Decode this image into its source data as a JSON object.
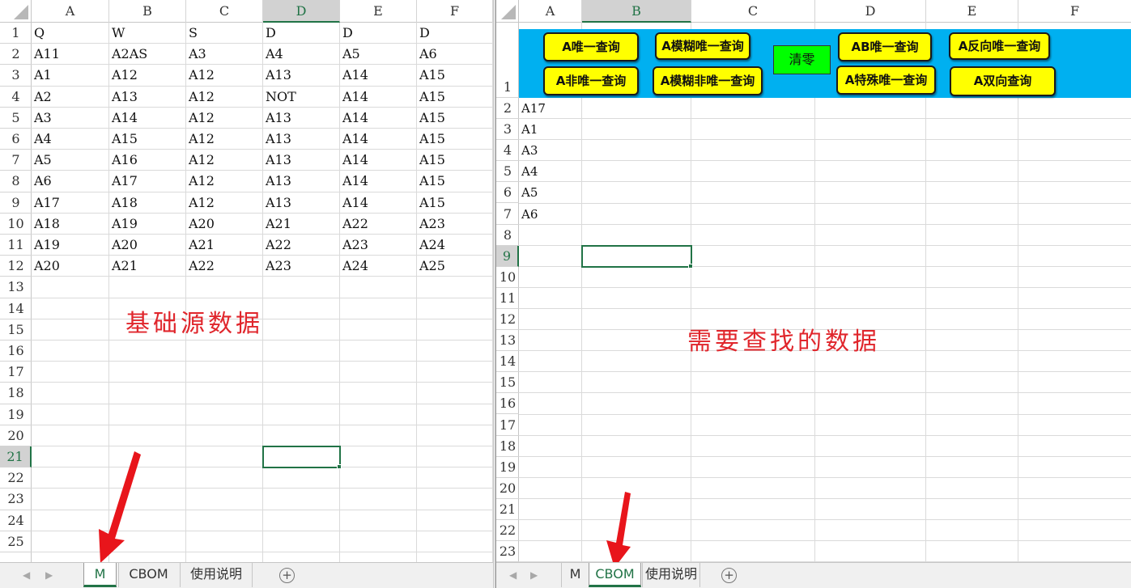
{
  "left_sheet": {
    "columns": [
      "A",
      "B",
      "C",
      "D",
      "E",
      "F"
    ],
    "active_column": "D",
    "row_numbers": [
      "1",
      "2",
      "3",
      "4",
      "5",
      "6",
      "7",
      "8",
      "9",
      "10",
      "11",
      "12",
      "13",
      "14",
      "15",
      "16",
      "17",
      "18",
      "19",
      "20",
      "21",
      "22",
      "23",
      "24",
      "25"
    ],
    "active_row": "21",
    "rows": [
      [
        "Q",
        "W",
        "S",
        "D",
        "D",
        "D"
      ],
      [
        "A11",
        "A2AS",
        "A3",
        "A4",
        "A5",
        "A6"
      ],
      [
        "A1",
        "A12",
        "A12",
        "A13",
        "A14",
        "A15"
      ],
      [
        "A2",
        "A13",
        "A12",
        "NOT",
        "A14",
        "A15"
      ],
      [
        "A3",
        "A14",
        "A12",
        "A13",
        "A14",
        "A15"
      ],
      [
        "A4",
        "A15",
        "A12",
        "A13",
        "A14",
        "A15"
      ],
      [
        "A5",
        "A16",
        "A12",
        "A13",
        "A14",
        "A15"
      ],
      [
        "A6",
        "A17",
        "A12",
        "A13",
        "A14",
        "A15"
      ],
      [
        "A17",
        "A18",
        "A12",
        "A13",
        "A14",
        "A15"
      ],
      [
        "A18",
        "A19",
        "A20",
        "A21",
        "A22",
        "A23"
      ],
      [
        "A19",
        "A20",
        "A21",
        "A22",
        "A23",
        "A24"
      ],
      [
        "A20",
        "A21",
        "A22",
        "A23",
        "A24",
        "A25"
      ]
    ],
    "annotation": "基础源数据",
    "tabs": [
      "M",
      "CBOM",
      "使用说明"
    ],
    "active_tab": "M"
  },
  "right_sheet": {
    "columns": [
      "A",
      "B",
      "C",
      "D",
      "E",
      "F"
    ],
    "active_column": "B",
    "row_numbers": [
      "1",
      "2",
      "3",
      "4",
      "5",
      "6",
      "7",
      "8",
      "9",
      "10",
      "11",
      "12",
      "13",
      "14",
      "15",
      "16",
      "17",
      "18",
      "19",
      "20",
      "21",
      "22",
      "23"
    ],
    "active_row": "9",
    "column_a_values": [
      "A17",
      "A1",
      "A3",
      "A4",
      "A5",
      "A6"
    ],
    "buttons": {
      "unique_lookup": "A唯一查询",
      "non_unique_lookup": "A非唯一查询",
      "fuzzy_unique_lookup": "A模糊唯一查询",
      "fuzzy_non_unique_lookup": "A模糊非唯一查询",
      "clear": "清零",
      "ab_unique_lookup": "AB唯一查询",
      "special_unique_lookup": "A特殊唯一查询",
      "reverse_unique_lookup": "A反向唯一查询",
      "bidirectional_lookup": "A双向查询"
    },
    "annotation": "需要查找的数据",
    "tabs": [
      "M",
      "CBOM",
      "使用说明"
    ],
    "active_tab": "CBOM"
  },
  "colors": {
    "banner": "#00b0f0",
    "button": "#ffff00",
    "clear_button": "#00ff00",
    "selection": "#217346",
    "annotation": "#e0262c"
  }
}
